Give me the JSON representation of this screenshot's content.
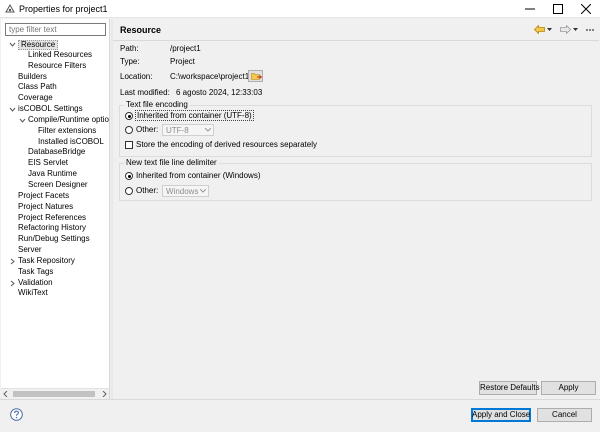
{
  "window": {
    "title": "Properties for project1"
  },
  "filter": {
    "placeholder": "type filter text"
  },
  "tree": {
    "items": [
      {
        "label": "Resource",
        "toggle": "expanded",
        "selected": true
      },
      {
        "label": "Linked Resources"
      },
      {
        "label": "Resource Filters"
      },
      {
        "label": "Builders"
      },
      {
        "label": "Class Path"
      },
      {
        "label": "Coverage"
      },
      {
        "label": "isCOBOL Settings",
        "toggle": "expanded"
      },
      {
        "label": "Compile/Runtime option",
        "toggle": "expanded"
      },
      {
        "label": "Filter extensions"
      },
      {
        "label": "Installed isCOBOL"
      },
      {
        "label": "DatabaseBridge"
      },
      {
        "label": "EIS Servlet"
      },
      {
        "label": "Java Runtime"
      },
      {
        "label": "Screen Designer"
      },
      {
        "label": "Project Facets"
      },
      {
        "label": "Project Natures"
      },
      {
        "label": "Project References"
      },
      {
        "label": "Refactoring History"
      },
      {
        "label": "Run/Debug Settings"
      },
      {
        "label": "Server"
      },
      {
        "label": "Task Repository",
        "toggle": "collapsed"
      },
      {
        "label": "Task Tags"
      },
      {
        "label": "Validation",
        "toggle": "collapsed"
      },
      {
        "label": "WikiText"
      }
    ]
  },
  "page": {
    "title": "Resource",
    "path_label": "Path:",
    "path_value": "/project1",
    "type_label": "Type:",
    "type_value": "Project",
    "location_label": "Location:",
    "location_value": "C:\\workspace\\project1",
    "modified_label": "Last modified:",
    "modified_value": "6 agosto 2024, 12:33:03"
  },
  "encoding": {
    "title": "Text file encoding",
    "inherited_label": "Inherited from container (UTF-8)",
    "other_label": "Other:",
    "other_value": "UTF-8",
    "store_label": "Store the encoding of derived resources separately"
  },
  "delimiter": {
    "title": "New text file line delimiter",
    "inherited_label": "Inherited from container (Windows)",
    "other_label": "Other:",
    "other_value": "Windows"
  },
  "buttons": {
    "restore_defaults": "Restore Defaults",
    "apply": "Apply",
    "apply_and_close": "Apply and Close",
    "cancel": "Cancel"
  },
  "colors": {
    "default_button_border": "#0078d7",
    "selection_bg": "#e5e5e5"
  }
}
